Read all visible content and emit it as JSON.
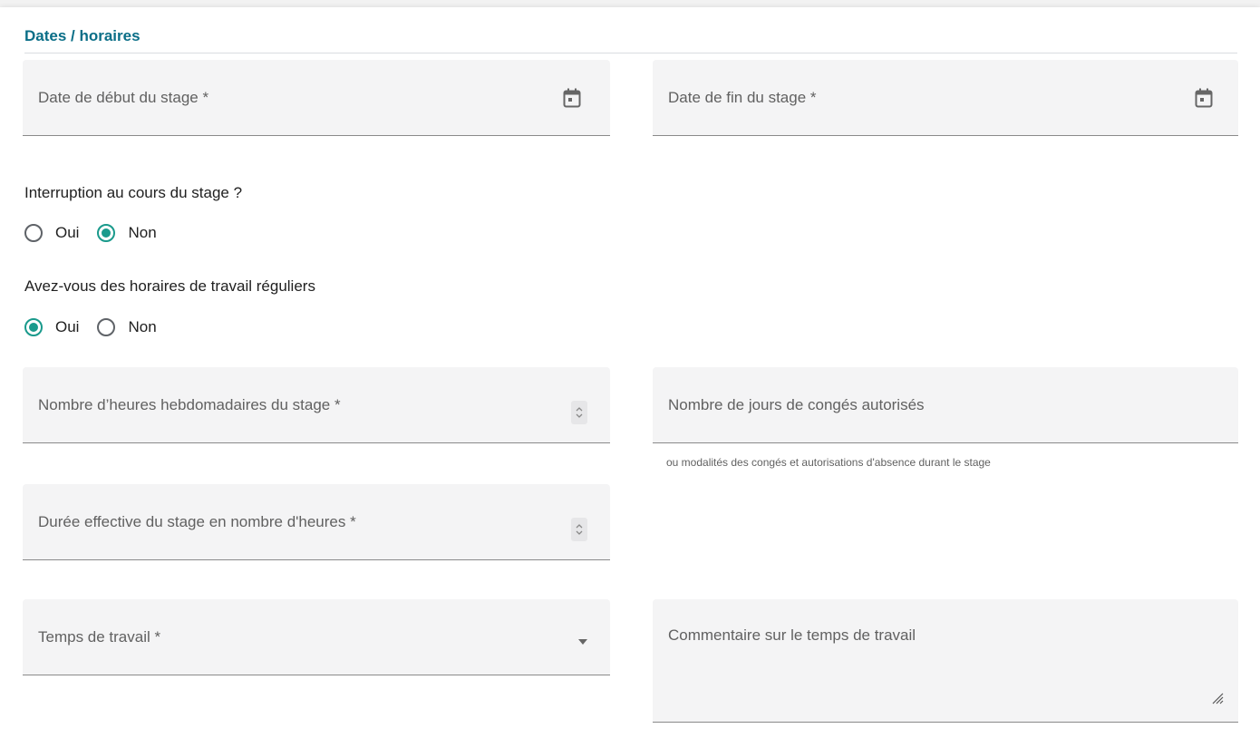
{
  "section": {
    "title": "Dates / horaires"
  },
  "fields": {
    "start_date": {
      "label": "Date de début du stage *",
      "icon": "calendar-icon"
    },
    "end_date": {
      "label": "Date de fin du stage *",
      "icon": "calendar-icon"
    },
    "weekly_hours": {
      "label": "Nombre d’heures hebdomadaires du stage *",
      "icon": "spinner-icon"
    },
    "leave_days": {
      "label": "Nombre de jours de congés autorisés",
      "hint": "ou modalités des congés et autorisations d'absence durant le stage"
    },
    "effective_duration": {
      "label": "Durée effective du stage en nombre d'heures *",
      "icon": "spinner-icon"
    },
    "work_time": {
      "label": "Temps de travail *",
      "icon": "dropdown-arrow-icon"
    },
    "work_time_comment": {
      "label": "Commentaire sur le temps de travail",
      "icon": "resize-handle-icon"
    }
  },
  "questions": {
    "interruption": {
      "label": "Interruption au cours du stage ?",
      "options": [
        "Oui",
        "Non"
      ],
      "selected": "Non"
    },
    "regular_hours": {
      "label": "Avez-vous des horaires de travail réguliers",
      "options": [
        "Oui",
        "Non"
      ],
      "selected": "Oui"
    }
  },
  "colors": {
    "accent": "#1a9a8c",
    "title": "#0a6e87",
    "field_background": "#f4f4f5"
  }
}
